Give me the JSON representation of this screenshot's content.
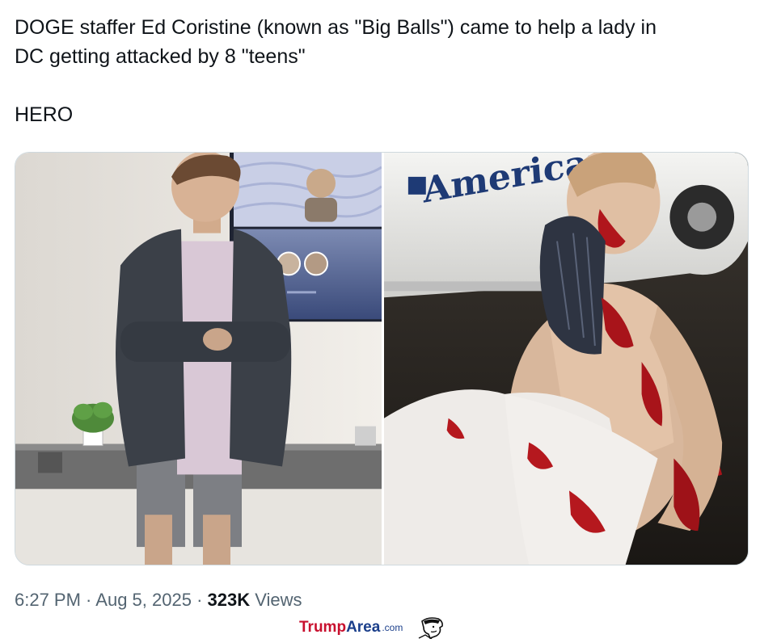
{
  "tweet": {
    "text_line1": "DOGE staffer Ed Coristine (known as \"Big Balls\") came to help a lady in",
    "text_line2": "DC getting attacked by 8 \"teens\"",
    "text_line3": "HERO"
  },
  "media": {
    "right_van_text": "American"
  },
  "meta": {
    "time": "6:27 PM",
    "separator": " · ",
    "date": "Aug 5, 2025",
    "separator2": " · ",
    "views_count": "323K",
    "views_label": " Views"
  },
  "watermark": {
    "part1": "Trump",
    "part2": "Area",
    "part3": ".com",
    "icon": "trump-caricature-icon"
  },
  "colors": {
    "text_primary": "#0f1419",
    "text_secondary": "#536471",
    "border": "#cfd9de",
    "watermark_red": "#c8102e",
    "watermark_blue": "#1b3f8b"
  }
}
